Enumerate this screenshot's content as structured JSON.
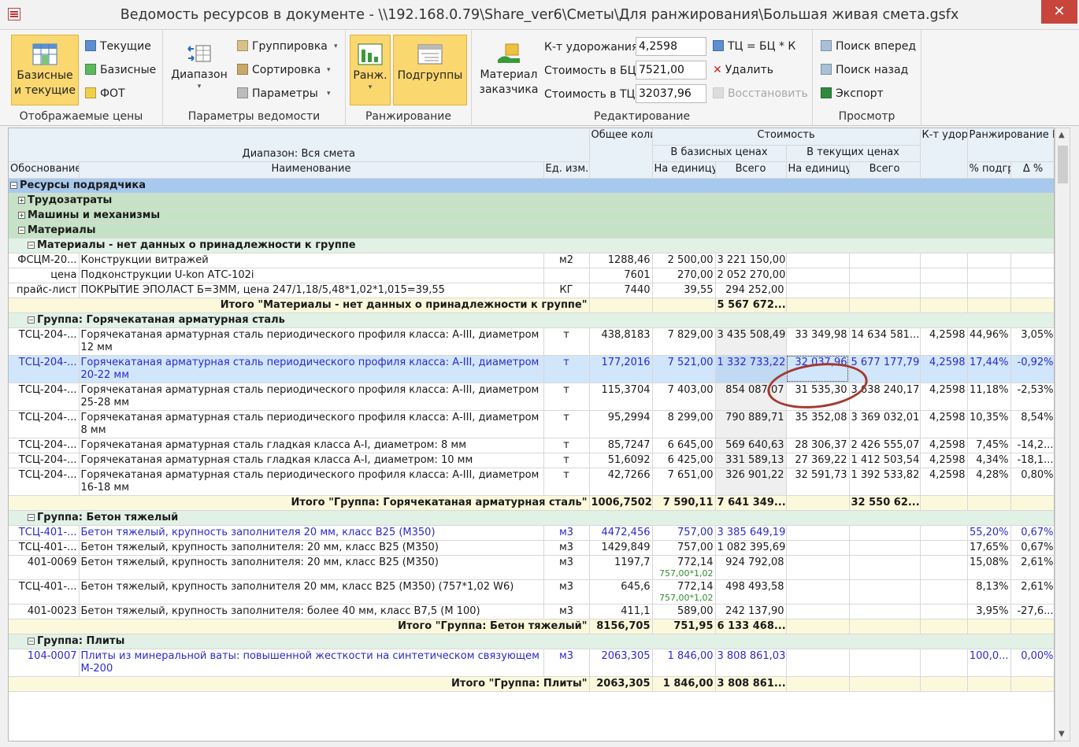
{
  "window": {
    "title": "Ведомость ресурсов в документе - \\\\192.168.0.79\\Share_ver6\\Сметы\\Для ранжирования\\Большая живая смета.gsfx",
    "close": "✕"
  },
  "ribbon": {
    "prices": {
      "caption": "Отображаемые цены",
      "base_current": "Базисные и текущие",
      "current": "Текущие",
      "base": "Базисные",
      "fot": "ФОТ"
    },
    "params": {
      "caption": "Параметры ведомости",
      "range": "Диапазон",
      "grouping": "Группировка",
      "sorting": "Сортировка",
      "parameters": "Параметры"
    },
    "ranking": {
      "caption": "Ранжирование",
      "rank": "Ранж.",
      "subgroups": "Подгруппы"
    },
    "edit": {
      "caption": "Редактирование",
      "customer_material": "Материал заказчика",
      "k_label": "К-т удорожания",
      "k_value": "4,2598",
      "bc_label": "Стоимость в БЦ",
      "bc_value": "7521,00",
      "tc_label": "Стоимость в ТЦ",
      "tc_value": "32037,96",
      "formula": "ТЦ = БЦ * К",
      "delete": "Удалить",
      "restore": "Восстановить"
    },
    "view": {
      "caption": "Просмотр",
      "find_next": "Поиск вперед",
      "find_prev": "Поиск назад",
      "export": "Экспорт"
    }
  },
  "grid": {
    "headers": {
      "range": "Диапазон: Вся смета",
      "basis": "Обоснование",
      "name": "Наименование",
      "unit": "Ед. изм.",
      "qty": "Общее количество",
      "cost": "Стоимость",
      "base_prices": "В базисных ценах",
      "cur_prices": "В текущих ценах",
      "per_unit": "На единицу",
      "total": "Всего",
      "k": "К-т удор. ТЦ=БЦ*К",
      "rank": "Ранжирование БЦ",
      "pct": "% подгр.",
      "delta": "Δ %"
    },
    "rows": [
      {
        "type": "g0",
        "name": "Ресурсы подрядчика",
        "sign": "−"
      },
      {
        "type": "g1",
        "name": "Трудозатраты",
        "sign": "+"
      },
      {
        "type": "g1",
        "name": "Машины и механизмы",
        "sign": "+"
      },
      {
        "type": "g1",
        "name": "Материалы",
        "sign": "−"
      },
      {
        "type": "g2",
        "name": "Материалы - нет данных о принадлежности к группе",
        "sign": "−"
      },
      {
        "type": "d",
        "basis": "ФСЦМ-20...",
        "name": "Конструкции витражей",
        "unit": "м2",
        "qty": "1288,46",
        "bpu": "2 500,00",
        "bt": "3 221 150,00"
      },
      {
        "type": "d",
        "basis": "цена",
        "name": "Подконструкции U-kon АТС-102i",
        "qty": "7601",
        "bpu": "270,00",
        "bt": "2 052 270,00"
      },
      {
        "type": "d",
        "basis": "прайс-лист",
        "name": "ПОКРЫТИЕ ЭПОЛАСТ Б=3ММ, цена 247/1,18/5,48*1,02*1,015=39,55",
        "unit": "КГ",
        "qty": "7440",
        "bpu": "39,55",
        "bt": "294 252,00"
      },
      {
        "type": "t",
        "label": "Итого \"Материалы - нет данных о принадлежности к группе\"",
        "bt": "5 567 672..."
      },
      {
        "type": "g2",
        "name": "Группа: Горячекатаная арматурная сталь",
        "sign": "−"
      },
      {
        "type": "d",
        "basis": "ТСЦ-204-...",
        "name": "Горячекатаная арматурная сталь периодического профиля класса: А-III, диаметром 12 мм",
        "unit": "т",
        "qty": "438,8183",
        "bpu": "7 829,00",
        "bt": "3 435 508,49",
        "cpu": "33 349,98",
        "ct": "14 634 581...",
        "k": "4,2598",
        "pct": "44,96%",
        "d": "3,05%"
      },
      {
        "type": "d",
        "sel": true,
        "basis": "ТСЦ-204-...",
        "name": "Горячекатаная арматурная сталь периодического профиля класса: А-III, диаметром 20-22 мм",
        "unit": "т",
        "qty": "177,2016",
        "bpu": "7 521,00",
        "bt": "1 332 733,22",
        "cpu": "32 037,96",
        "ct": "5 677 177,79",
        "k": "4,2598",
        "pct": "17,44%",
        "d": "-0,92%"
      },
      {
        "type": "d",
        "basis": "ТСЦ-204-...",
        "name": "Горячекатаная арматурная сталь периодического профиля класса: А-III, диаметром 25-28 мм",
        "unit": "т",
        "qty": "115,3704",
        "bpu": "7 403,00",
        "bt": "854 087,07",
        "cpu": "31 535,30",
        "ct": "3 638 240,17",
        "k": "4,2598",
        "pct": "11,18%",
        "d": "-2,53%"
      },
      {
        "type": "d",
        "basis": "ТСЦ-204-...",
        "name": "Горячекатаная арматурная сталь периодического профиля класса: А-III, диаметром 8 мм",
        "unit": "т",
        "qty": "95,2994",
        "bpu": "8 299,00",
        "bt": "790 889,71",
        "cpu": "35 352,08",
        "ct": "3 369 032,01",
        "k": "4,2598",
        "pct": "10,35%",
        "d": "8,54%"
      },
      {
        "type": "d",
        "basis": "ТСЦ-204-...",
        "name": "Горячекатаная арматурная сталь гладкая класса А-I, диаметром: 8 мм",
        "unit": "т",
        "qty": "85,7247",
        "bpu": "6 645,00",
        "bt": "569 640,63",
        "cpu": "28 306,37",
        "ct": "2 426 555,07",
        "k": "4,2598",
        "pct": "7,45%",
        "d": "-14,2..."
      },
      {
        "type": "d",
        "basis": "ТСЦ-204-...",
        "name": "Горячекатаная арматурная сталь гладкая класса А-I, диаметром: 10 мм",
        "unit": "т",
        "qty": "51,6092",
        "bpu": "6 425,00",
        "bt": "331 589,13",
        "cpu": "27 369,22",
        "ct": "1 412 503,54",
        "k": "4,2598",
        "pct": "4,34%",
        "d": "-18,1..."
      },
      {
        "type": "d",
        "basis": "ТСЦ-204-...",
        "name": "Горячекатаная арматурная сталь периодического профиля класса: А-III, диаметром 16-18 мм",
        "unit": "т",
        "qty": "42,7266",
        "bpu": "7 651,00",
        "bt": "326 901,22",
        "cpu": "32 591,73",
        "ct": "1 392 533,82",
        "k": "4,2598",
        "pct": "4,28%",
        "d": "0,80%"
      },
      {
        "type": "t",
        "label": "Итого \"Группа: Горячекатаная арматурная сталь\"",
        "qty": "1006,7502",
        "bpu": "7 590,11",
        "bt": "7 641 349...",
        "ct": "32 550 62..."
      },
      {
        "type": "g2",
        "name": "Группа: Бетон тяжелый",
        "sign": "−"
      },
      {
        "type": "d",
        "blue": true,
        "basis": "ТСЦ-401-...",
        "name": "Бетон тяжелый, крупность заполнителя 20 мм, класс В25 (М350)",
        "unit": "м3",
        "qty": "4472,456",
        "bpu": "757,00",
        "bt": "3 385 649,19",
        "pct": "55,20%",
        "d": "0,67%"
      },
      {
        "type": "d",
        "basis": "ТСЦ-401-...",
        "name": "Бетон тяжелый, крупность заполнителя: 20 мм, класс В25 (М350)",
        "unit": "м3",
        "qty": "1429,849",
        "bpu": "757,00",
        "bt": "1 082 395,69",
        "pct": "17,65%",
        "d": "0,67%"
      },
      {
        "type": "d",
        "basis": "401-0069",
        "name": "Бетон тяжелый, крупность заполнителя: 20 мм, класс В25 (М350)",
        "unit": "м3",
        "qty": "1197,7",
        "bpu": "772,14",
        "bpu_sub": "757,00*1,02",
        "bt": "924 792,08",
        "pct": "15,08%",
        "d": "2,61%"
      },
      {
        "type": "d",
        "basis": "ТСЦ-401-...",
        "name": "Бетон тяжелый, крупность заполнителя 20 мм, класс В25 (М350) (757*1,02 W6)",
        "unit": "м3",
        "qty": "645,6",
        "bpu": "772,14",
        "bpu_sub": "757,00*1,02",
        "bt": "498 493,58",
        "pct": "8,13%",
        "d": "2,61%"
      },
      {
        "type": "d",
        "basis": "401-0023",
        "name": "Бетон тяжелый, крупность заполнителя: более 40 мм, класс В7,5 (М 100)",
        "unit": "м3",
        "qty": "411,1",
        "bpu": "589,00",
        "bt": "242 137,90",
        "pct": "3,95%",
        "d": "-27,6..."
      },
      {
        "type": "t",
        "label": "Итого \"Группа: Бетон тяжелый\"",
        "qty": "8156,705",
        "bpu": "751,95",
        "bt": "6 133 468..."
      },
      {
        "type": "g2",
        "name": "Группа: Плиты",
        "sign": "−"
      },
      {
        "type": "d",
        "blue": true,
        "basis": "104-0007",
        "name": "Плиты из минеральной ваты: повышенной жесткости на синтетическом связующем М-200",
        "unit": "м3",
        "qty": "2063,305",
        "bpu": "1 846,00",
        "bt": "3 808 861,03",
        "pct": "100,0...",
        "d": "0,00%"
      },
      {
        "type": "t",
        "label": "Итого \"Группа: Плиты\"",
        "qty": "2063,305",
        "bpu": "1 846,00",
        "bt": "3 808 861..."
      }
    ]
  },
  "colors": {
    "ribbon_active": "#fbd770",
    "group0": "#a8c9ee",
    "group1": "#c6e2c6",
    "selected_row": "#d1e6fb",
    "annotation": "#a33a30"
  },
  "icons": [
    "app-icon",
    "close-icon",
    "grid-icon",
    "range-icon",
    "grouping-icon",
    "sorting-icon",
    "parameters-icon",
    "rank-chart-icon",
    "subgroups-icon",
    "customer-material-icon",
    "formula-icon",
    "delete-icon",
    "restore-icon",
    "find-next-icon",
    "find-prev-icon",
    "excel-icon"
  ]
}
